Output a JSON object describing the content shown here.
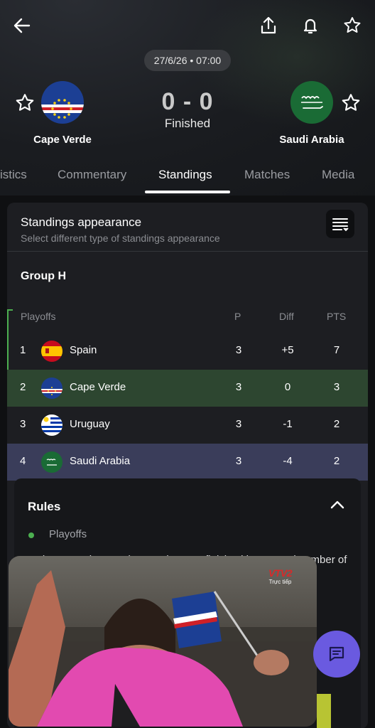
{
  "header": {
    "date_time": "27/6/26 • 07:00",
    "score": "0 - 0",
    "status": "Finished",
    "home_team": "Cape Verde",
    "away_team": "Saudi Arabia",
    "home_flag_icon": "cape-verde-flag-icon",
    "away_flag_icon": "saudi-arabia-flag-icon"
  },
  "tabs": [
    {
      "label": "istics",
      "active": false
    },
    {
      "label": "Commentary",
      "active": false
    },
    {
      "label": "Standings",
      "active": true
    },
    {
      "label": "Matches",
      "active": false
    },
    {
      "label": "Media",
      "active": false
    }
  ],
  "appearance": {
    "title": "Standings appearance",
    "subtitle": "Select different type of standings appearance"
  },
  "group": {
    "title": "Group H",
    "columns": [
      "Playoffs",
      "P",
      "Diff",
      "PTS"
    ],
    "rows": [
      {
        "pos": "1",
        "team": "Spain",
        "p": "3",
        "diff": "+5",
        "pts": "7",
        "highlight": "none"
      },
      {
        "pos": "2",
        "team": "Cape Verde",
        "p": "3",
        "diff": "0",
        "pts": "3",
        "highlight": "#2d4630"
      },
      {
        "pos": "3",
        "team": "Uruguay",
        "p": "3",
        "diff": "-1",
        "pts": "2",
        "highlight": "none"
      },
      {
        "pos": "4",
        "team": "Saudi Arabia",
        "p": "3",
        "diff": "-4",
        "pts": "2",
        "highlight": "#3a3d5a"
      }
    ]
  },
  "rules": {
    "title": "Rules",
    "legend": "Playoffs",
    "text": "In the event that two (or more) teams finish with an equal number of"
  },
  "video": {
    "channel": "VTV2",
    "channel_sub": "Trực tiếp"
  },
  "colors": {
    "playoff": "#4caf50",
    "fab": "#6a5ae0"
  }
}
